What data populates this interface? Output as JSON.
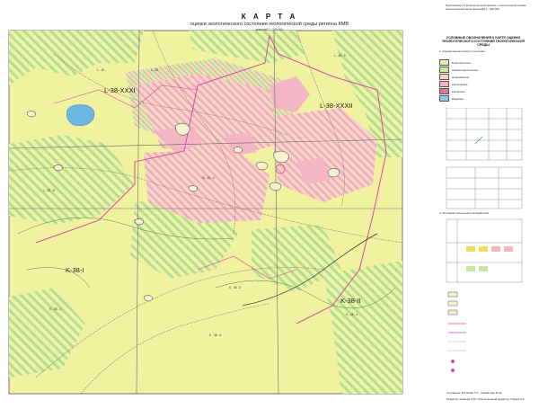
{
  "title": {
    "main": "К А Р Т А",
    "subtitle": "оценки экологического состояния геологической среды региона КМВ",
    "scale": "масштаб 1 : 200 000"
  },
  "regions": [
    {
      "id": "L38XXXI",
      "label": "L-38-XXXI"
    },
    {
      "id": "L38XXXII",
      "label": "L-38-XXXII"
    },
    {
      "id": "K38I",
      "label": "K-38-I"
    },
    {
      "id": "K38II",
      "label": "K-38-II"
    }
  ],
  "sheet_labels": [
    "L - 38 - ",
    "L - 38 - ",
    "L - 38 - 9",
    "M - 38 - 4",
    "L - 38 - 8",
    "K - 38 - 1",
    "K - 38 - 5",
    "K - 38 - 6",
    "K - 38 - 3"
  ],
  "legend": {
    "header_right_top": "Приложение 4 к Пояснительной записке к геологической основе экологической карты масштаба 1 : 200 000",
    "heading": "УСЛОВНЫЕ ОБОЗНАЧЕНИЯ К КАРТЕ ОЦЕНКИ ЭКОЛОГИЧЕСКОГО СОСТОЯНИЯ ГЕОЛОГИЧЕСКОЙ СРЕДЫ",
    "section_1": "1. Оценка экологического состояния",
    "section_2": "2. Источники техногенного воздействия",
    "items": [
      {
        "label": "Благоприятное",
        "color": "#dff0a8"
      },
      {
        "label": "Удовлетворительное",
        "color": "#c8e7a0"
      },
      {
        "label": "Напряжённое",
        "color": "#f7d6b0"
      },
      {
        "label": "Критическое",
        "color": "#f4b4c0"
      },
      {
        "label": "Кризисное",
        "color": "#e07890"
      },
      {
        "label": "Водоёмы",
        "color": "#8fc8e8"
      }
    ]
  },
  "footer": {
    "authors": "Составили: Б.Б.Шабо Т.С., Самойлова Ю.Д.",
    "editor": "Редактор: Ковалёв А.Ю. Ответственный редактор: Грачев Н.А."
  },
  "colors": {
    "base": "#f1f2a0",
    "green_hatch": "#a6d99a",
    "pink_hatch": "#f2aebd",
    "pink_solid": "#f4b6c4",
    "water": "#6cb6e3",
    "boundary": "#d84da0",
    "road": "#8a7a6a"
  }
}
